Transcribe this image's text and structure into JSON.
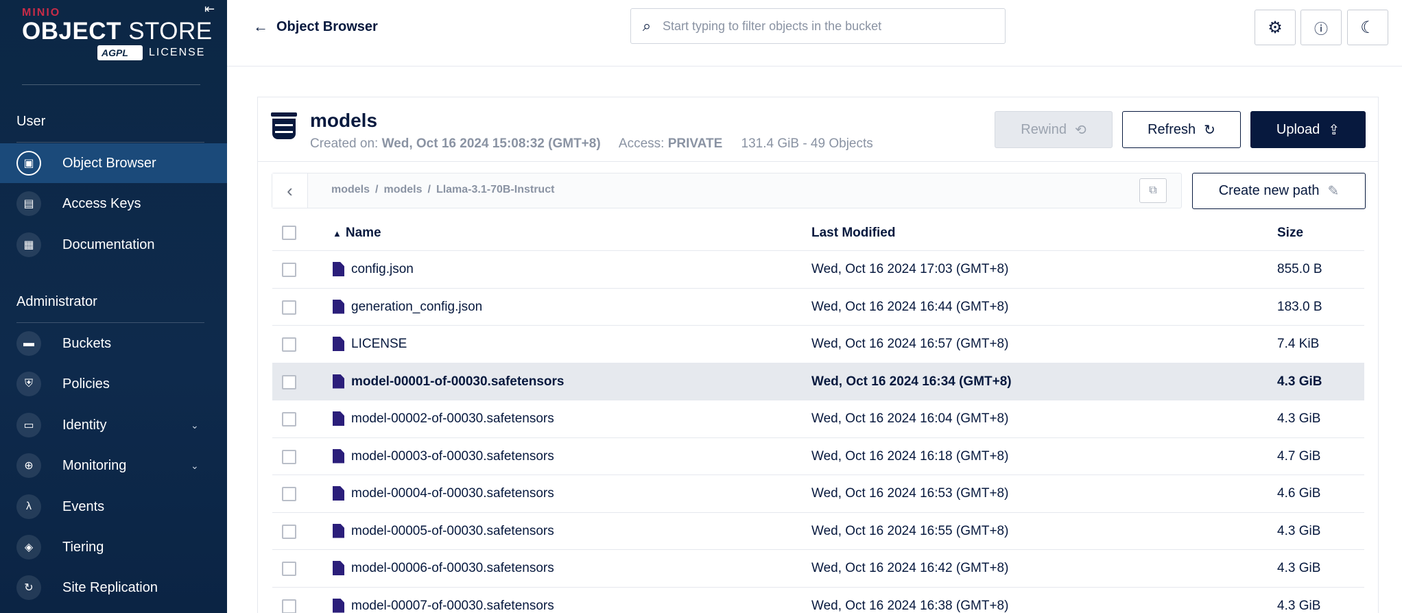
{
  "sidebar": {
    "logo": {
      "brand": "MINIO",
      "product_bold": "OBJECT",
      "product_light": " STORE",
      "badge": "AGPL",
      "license": "LICENSE"
    },
    "collapse_icon": "collapse-left-icon",
    "user_section": "User",
    "admin_section": "Administrator",
    "user_items": [
      {
        "label": "Object Browser",
        "icon": "object-browser-icon",
        "active": true
      },
      {
        "label": "Access Keys",
        "icon": "access-keys-icon"
      },
      {
        "label": "Documentation",
        "icon": "documentation-icon"
      }
    ],
    "admin_items": [
      {
        "label": "Buckets",
        "icon": "bucket-icon"
      },
      {
        "label": "Policies",
        "icon": "policy-icon"
      },
      {
        "label": "Identity",
        "icon": "identity-icon",
        "expandable": true
      },
      {
        "label": "Monitoring",
        "icon": "monitoring-icon",
        "expandable": true
      },
      {
        "label": "Events",
        "icon": "lambda-icon"
      },
      {
        "label": "Tiering",
        "icon": "tiering-icon"
      },
      {
        "label": "Site Replication",
        "icon": "replication-icon"
      }
    ]
  },
  "topbar": {
    "back_label": "Object Browser",
    "search_placeholder": "Start typing to filter objects in the bucket",
    "buttons": [
      "settings-icon",
      "help-icon",
      "dark-mode-icon"
    ]
  },
  "bucket": {
    "name": "models",
    "created_label": "Created on:",
    "created_value": "Wed, Oct 16 2024 15:08:32 (GMT+8)",
    "access_label": "Access:",
    "access_value": "PRIVATE",
    "usage": "131.4 GiB - 49 Objects",
    "rewind_label": "Rewind",
    "refresh_label": "Refresh",
    "upload_label": "Upload"
  },
  "path": {
    "crumbs": [
      "models",
      "models",
      "Llama-3.1-70B-Instruct"
    ],
    "separator": "/",
    "create_label": "Create new path"
  },
  "table": {
    "columns": {
      "name": "Name",
      "modified": "Last Modified",
      "size": "Size"
    },
    "rows": [
      {
        "name": "config.json",
        "modified": "Wed, Oct 16 2024 17:03 (GMT+8)",
        "size": "855.0 B"
      },
      {
        "name": "generation_config.json",
        "modified": "Wed, Oct 16 2024 16:44 (GMT+8)",
        "size": "183.0 B"
      },
      {
        "name": "LICENSE",
        "modified": "Wed, Oct 16 2024 16:57 (GMT+8)",
        "size": "7.4 KiB"
      },
      {
        "name": "model-00001-of-00030.safetensors",
        "modified": "Wed, Oct 16 2024 16:34 (GMT+8)",
        "size": "4.3 GiB",
        "highlighted": true
      },
      {
        "name": "model-00002-of-00030.safetensors",
        "modified": "Wed, Oct 16 2024 16:04 (GMT+8)",
        "size": "4.3 GiB"
      },
      {
        "name": "model-00003-of-00030.safetensors",
        "modified": "Wed, Oct 16 2024 16:18 (GMT+8)",
        "size": "4.7 GiB"
      },
      {
        "name": "model-00004-of-00030.safetensors",
        "modified": "Wed, Oct 16 2024 16:53 (GMT+8)",
        "size": "4.6 GiB"
      },
      {
        "name": "model-00005-of-00030.safetensors",
        "modified": "Wed, Oct 16 2024 16:55 (GMT+8)",
        "size": "4.3 GiB"
      },
      {
        "name": "model-00006-of-00030.safetensors",
        "modified": "Wed, Oct 16 2024 16:42 (GMT+8)",
        "size": "4.3 GiB"
      },
      {
        "name": "model-00007-of-00030.safetensors",
        "modified": "Wed, Oct 16 2024 16:38 (GMT+8)",
        "size": "4.3 GiB"
      }
    ]
  },
  "colors": {
    "navy": "#07193e",
    "sidebar": "#0c2745",
    "sidebar_active": "#1b4a7a",
    "brand_red": "#c72c48",
    "file_icon": "#2b1e7a",
    "row_highlight": "#e6e9ee"
  }
}
